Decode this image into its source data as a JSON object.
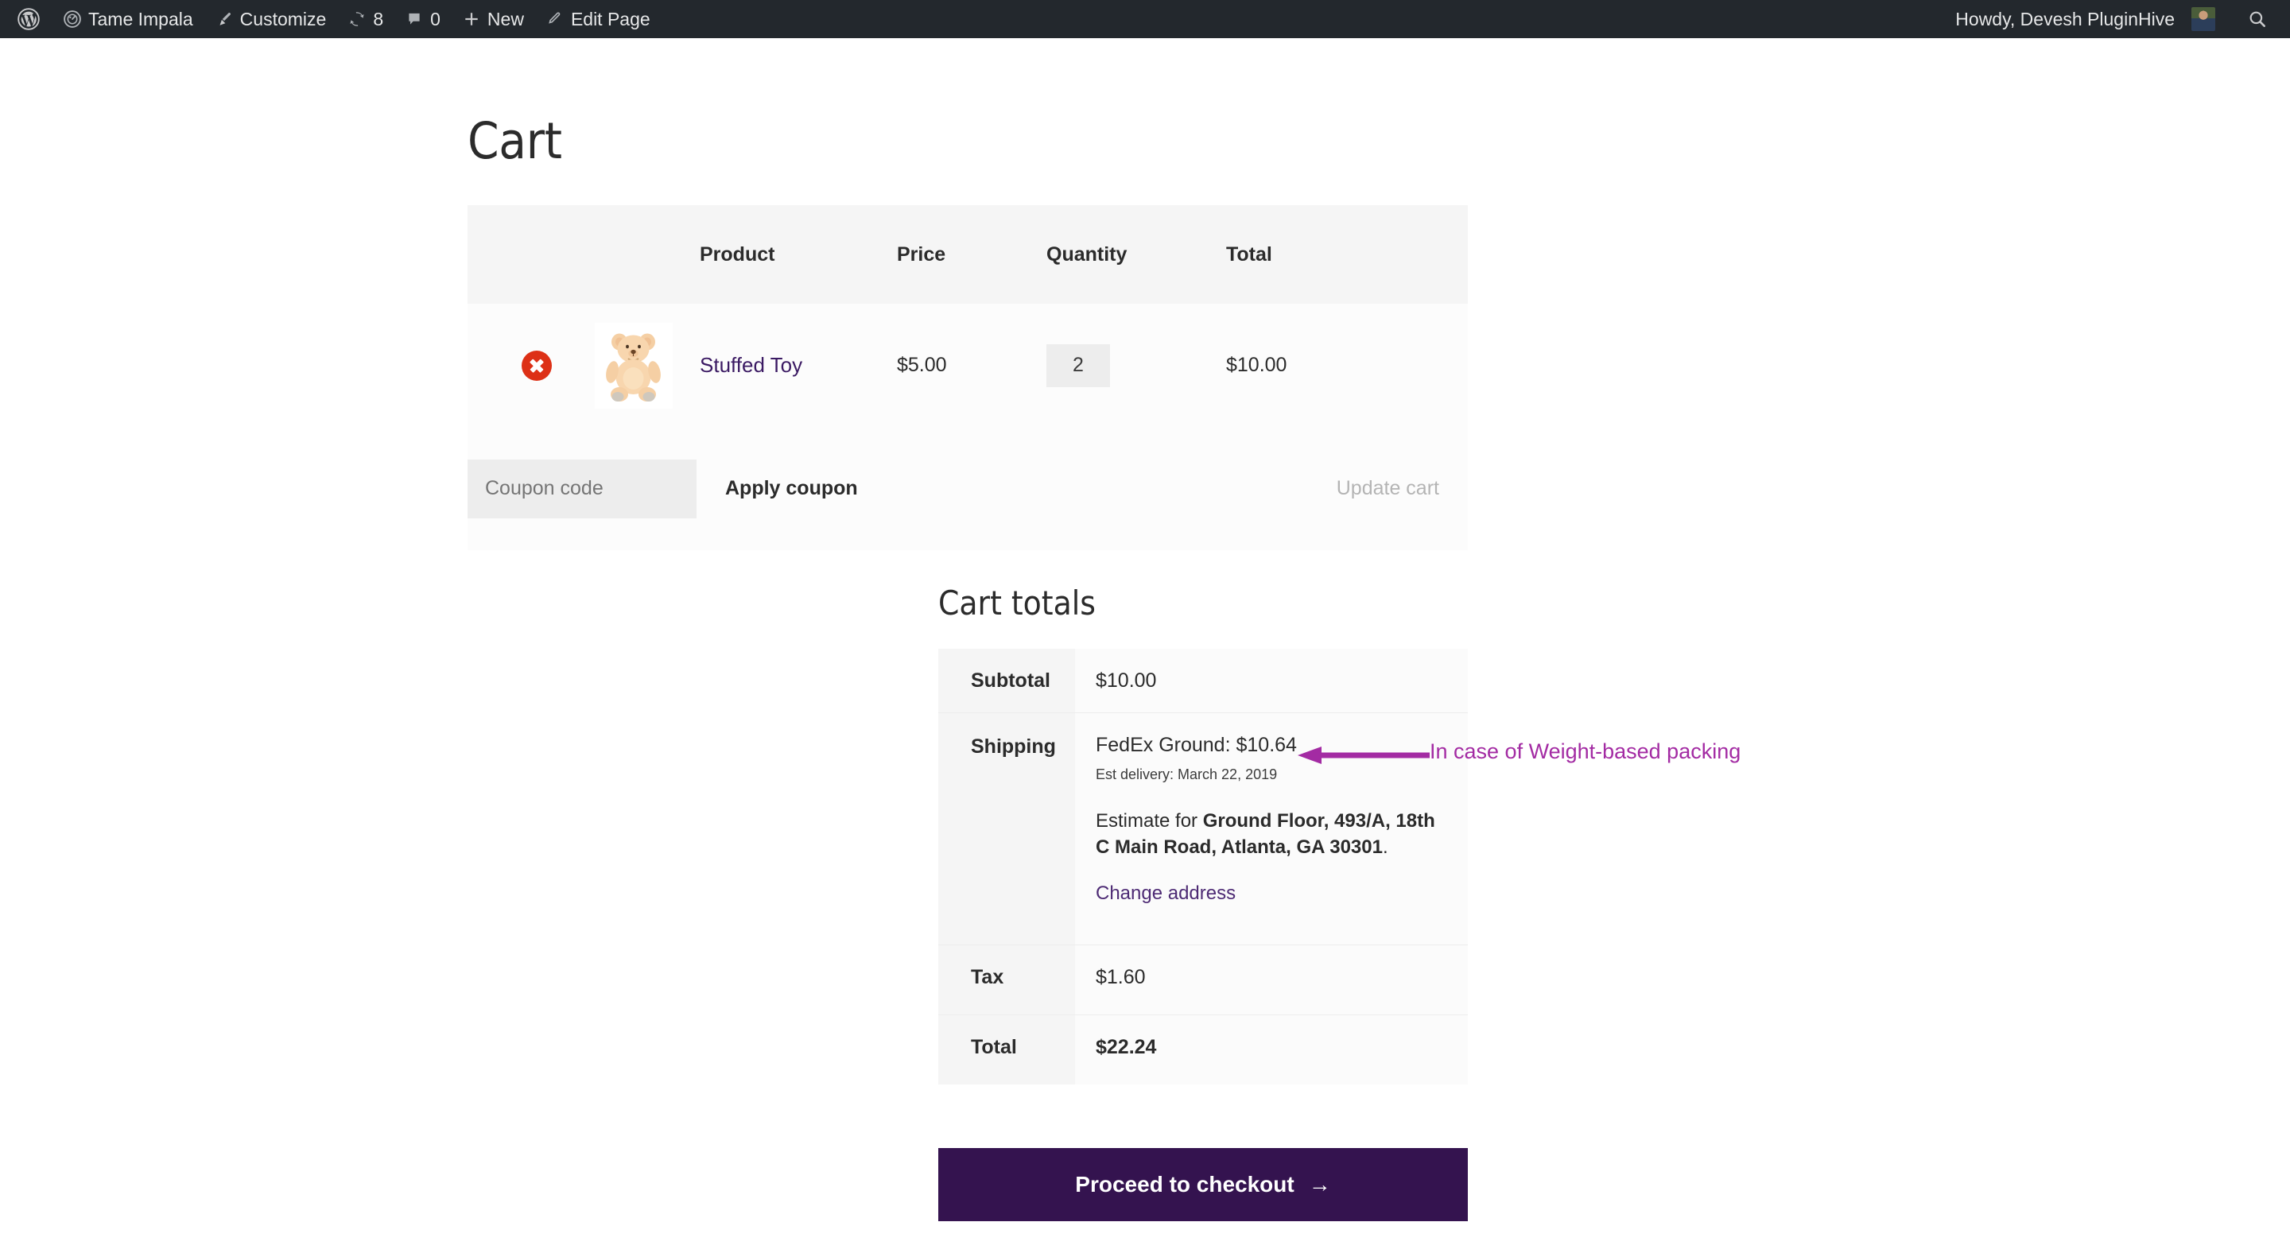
{
  "adminbar": {
    "left_items": [
      {
        "icon": "wordpress-logo-icon",
        "label": ""
      },
      {
        "icon": "dashboard-icon",
        "label": "Tame Impala"
      },
      {
        "icon": "brush-icon",
        "label": "Customize"
      },
      {
        "icon": "updates-icon",
        "label": "8"
      },
      {
        "icon": "comment-bubble-icon",
        "label": "0"
      },
      {
        "icon": "plus-icon",
        "label": "New"
      },
      {
        "icon": "pencil-icon",
        "label": "Edit Page"
      }
    ],
    "howdy": "Howdy, Devesh PluginHive",
    "avatar_alt": "user-avatar",
    "search_icon": "search-icon"
  },
  "page": {
    "title": "Cart"
  },
  "cart_table": {
    "headers": [
      "",
      "",
      "Product",
      "Price",
      "Quantity",
      "Total"
    ],
    "rows": [
      {
        "remove_label": "×",
        "thumb_alt": "stuffed-toy-thumbnail",
        "product": "Stuffed Toy",
        "price": "$5.00",
        "quantity": "2",
        "total": "$10.00"
      }
    ],
    "coupon": {
      "placeholder": "Coupon code",
      "value": "",
      "apply_label": "Apply coupon",
      "update_label": "Update cart"
    }
  },
  "cart_totals": {
    "title": "Cart totals",
    "subtotal_label": "Subtotal",
    "subtotal_value": "$10.00",
    "shipping_label": "Shipping",
    "shipping_method": "FedEx Ground: $10.64",
    "shipping_eta": "Est delivery: March 22, 2019",
    "estimate_prefix": "Estimate for ",
    "estimate_address": "Ground Floor, 493/A, 18th C Main Road, Atlanta, GA 30301",
    "estimate_suffix": ".",
    "change_address_label": "Change address",
    "tax_label": "Tax",
    "tax_value": "$1.60",
    "total_label": "Total",
    "total_value": "$22.24"
  },
  "annotation": {
    "text": "In case of Weight-based packing",
    "color": "#a32ba3"
  },
  "checkout": {
    "label": "Proceed to checkout",
    "arrow": "→",
    "color": "#34134f"
  },
  "colors": {
    "adminbar_bg": "#23282d",
    "table_header_bg": "#f5f5f5",
    "link_purple": "#3b1a63",
    "remove_red": "#dd3016"
  }
}
